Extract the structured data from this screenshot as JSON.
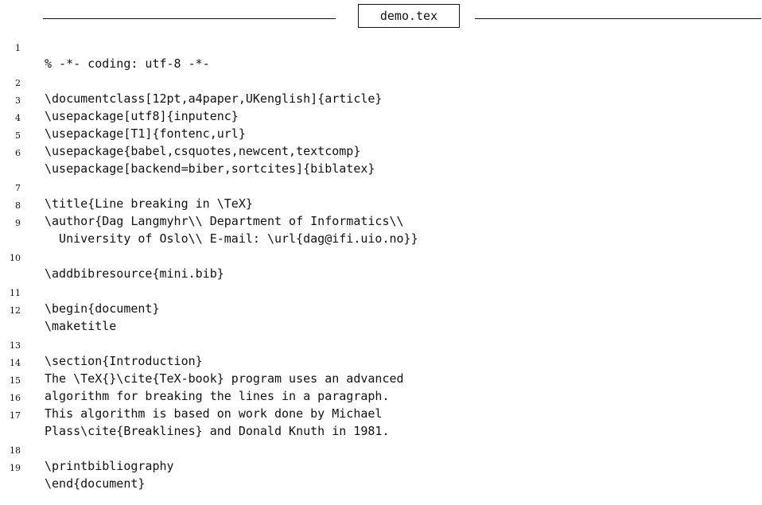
{
  "filename": "demo.tex",
  "lines": [
    {
      "number": "1",
      "text": "% -*- coding: utf-8 -*-"
    },
    {
      "number": "2",
      "text": "\\documentclass[12pt,a4paper,UKenglish]{article}"
    },
    {
      "number": "3",
      "text": "\\usepackage[utf8]{inputenc}"
    },
    {
      "number": "4",
      "text": "\\usepackage[T1]{fontenc,url}"
    },
    {
      "number": "5",
      "text": "\\usepackage{babel,csquotes,newcent,textcomp}"
    },
    {
      "number": "6",
      "text": "\\usepackage[backend=biber,sortcites]{biblatex}"
    },
    {
      "number": "7",
      "text": "\\title{Line breaking in \\TeX}"
    },
    {
      "number": "8",
      "text": "\\author{Dag Langmyhr\\\\ Department of Informatics\\\\"
    },
    {
      "number": "9",
      "text": "  University of Oslo\\\\ E-mail: \\url{dag@ifi.uio.no}}"
    },
    {
      "number": "10",
      "text": "\\addbibresource{mini.bib}"
    },
    {
      "number": "11",
      "text": "\\begin{document}"
    },
    {
      "number": "12",
      "text": "\\maketitle"
    },
    {
      "number": "13",
      "text": "\\section{Introduction}"
    },
    {
      "number": "14",
      "text": "The \\TeX{}\\cite{TeX-book} program uses an advanced"
    },
    {
      "number": "15",
      "text": "algorithm for breaking the lines in a paragraph."
    },
    {
      "number": "16",
      "text": "This algorithm is based on work done by Michael"
    },
    {
      "number": "17",
      "text": "Plass\\cite{Breaklines} and Donald Knuth in 1981."
    },
    {
      "number": "18",
      "text": "\\printbibliography"
    },
    {
      "number": "19",
      "text": "\\end{document}"
    }
  ]
}
